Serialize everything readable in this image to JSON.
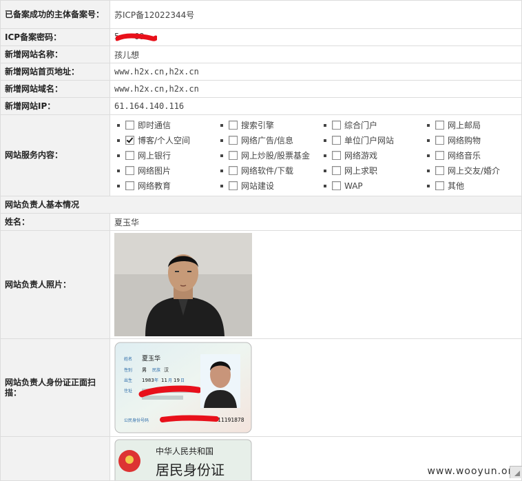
{
  "rows": {
    "main_record": {
      "label": "已备案成功的主体备案号：",
      "value": "苏ICP备12022344号"
    },
    "icp_password": {
      "label": "ICP备案密码：",
      "value": "5•••68"
    },
    "site_name": {
      "label": "新增网站名称：",
      "value": "孩儿想"
    },
    "site_home": {
      "label": "新增网站首页地址：",
      "value": "www.h2x.cn,h2x.cn"
    },
    "site_domain": {
      "label": "新增网站域名：",
      "value": "www.h2x.cn,h2x.cn"
    },
    "site_ip": {
      "label": "新增网站IP：",
      "value": "61.164.140.116"
    },
    "services_label": "网站服务内容：",
    "owner_section": "网站负责人基本情况",
    "owner_name": {
      "label": "姓名：",
      "value": "夏玉华"
    },
    "owner_photo_label": "网站负责人照片：",
    "id_front_label": "网站负责人身份证正面扫描："
  },
  "services": [
    {
      "label": "即时通信",
      "checked": false
    },
    {
      "label": "搜索引擎",
      "checked": false
    },
    {
      "label": "综合门户",
      "checked": false
    },
    {
      "label": "网上邮局",
      "checked": false
    },
    {
      "label": "博客/个人空间",
      "checked": true
    },
    {
      "label": "网络广告/信息",
      "checked": false
    },
    {
      "label": "单位门户网站",
      "checked": false
    },
    {
      "label": "网络购物",
      "checked": false
    },
    {
      "label": "网上银行",
      "checked": false
    },
    {
      "label": "网上炒股/股票基金",
      "checked": false
    },
    {
      "label": "网络游戏",
      "checked": false
    },
    {
      "label": "网络音乐",
      "checked": false
    },
    {
      "label": "网络图片",
      "checked": false
    },
    {
      "label": "网络软件/下载",
      "checked": false
    },
    {
      "label": "网上求职",
      "checked": false
    },
    {
      "label": "网上交友/婚介",
      "checked": false
    },
    {
      "label": "网络教育",
      "checked": false
    },
    {
      "label": "网站建设",
      "checked": false
    },
    {
      "label": "WAP",
      "checked": false
    },
    {
      "label": "其他",
      "checked": false
    }
  ],
  "id_card": {
    "name_label": "姓名",
    "name": "夏玉华",
    "sex_label": "性别",
    "sex": "男",
    "nation_label": "民族",
    "nation": "汉",
    "birth_label": "出生",
    "year": "1983",
    "month": "11",
    "day": "19",
    "addr_label": "住址",
    "id_label": "公民身份号码",
    "id_tail": "11191878"
  },
  "id_back": {
    "title": "中华人民共和国",
    "subtitle": "居民身份证"
  },
  "watermark": "www.wooyun.org",
  "colors": {
    "label_bg": "#f2f2f2",
    "border": "#dcdcdc",
    "redaction": "#e8101a"
  }
}
